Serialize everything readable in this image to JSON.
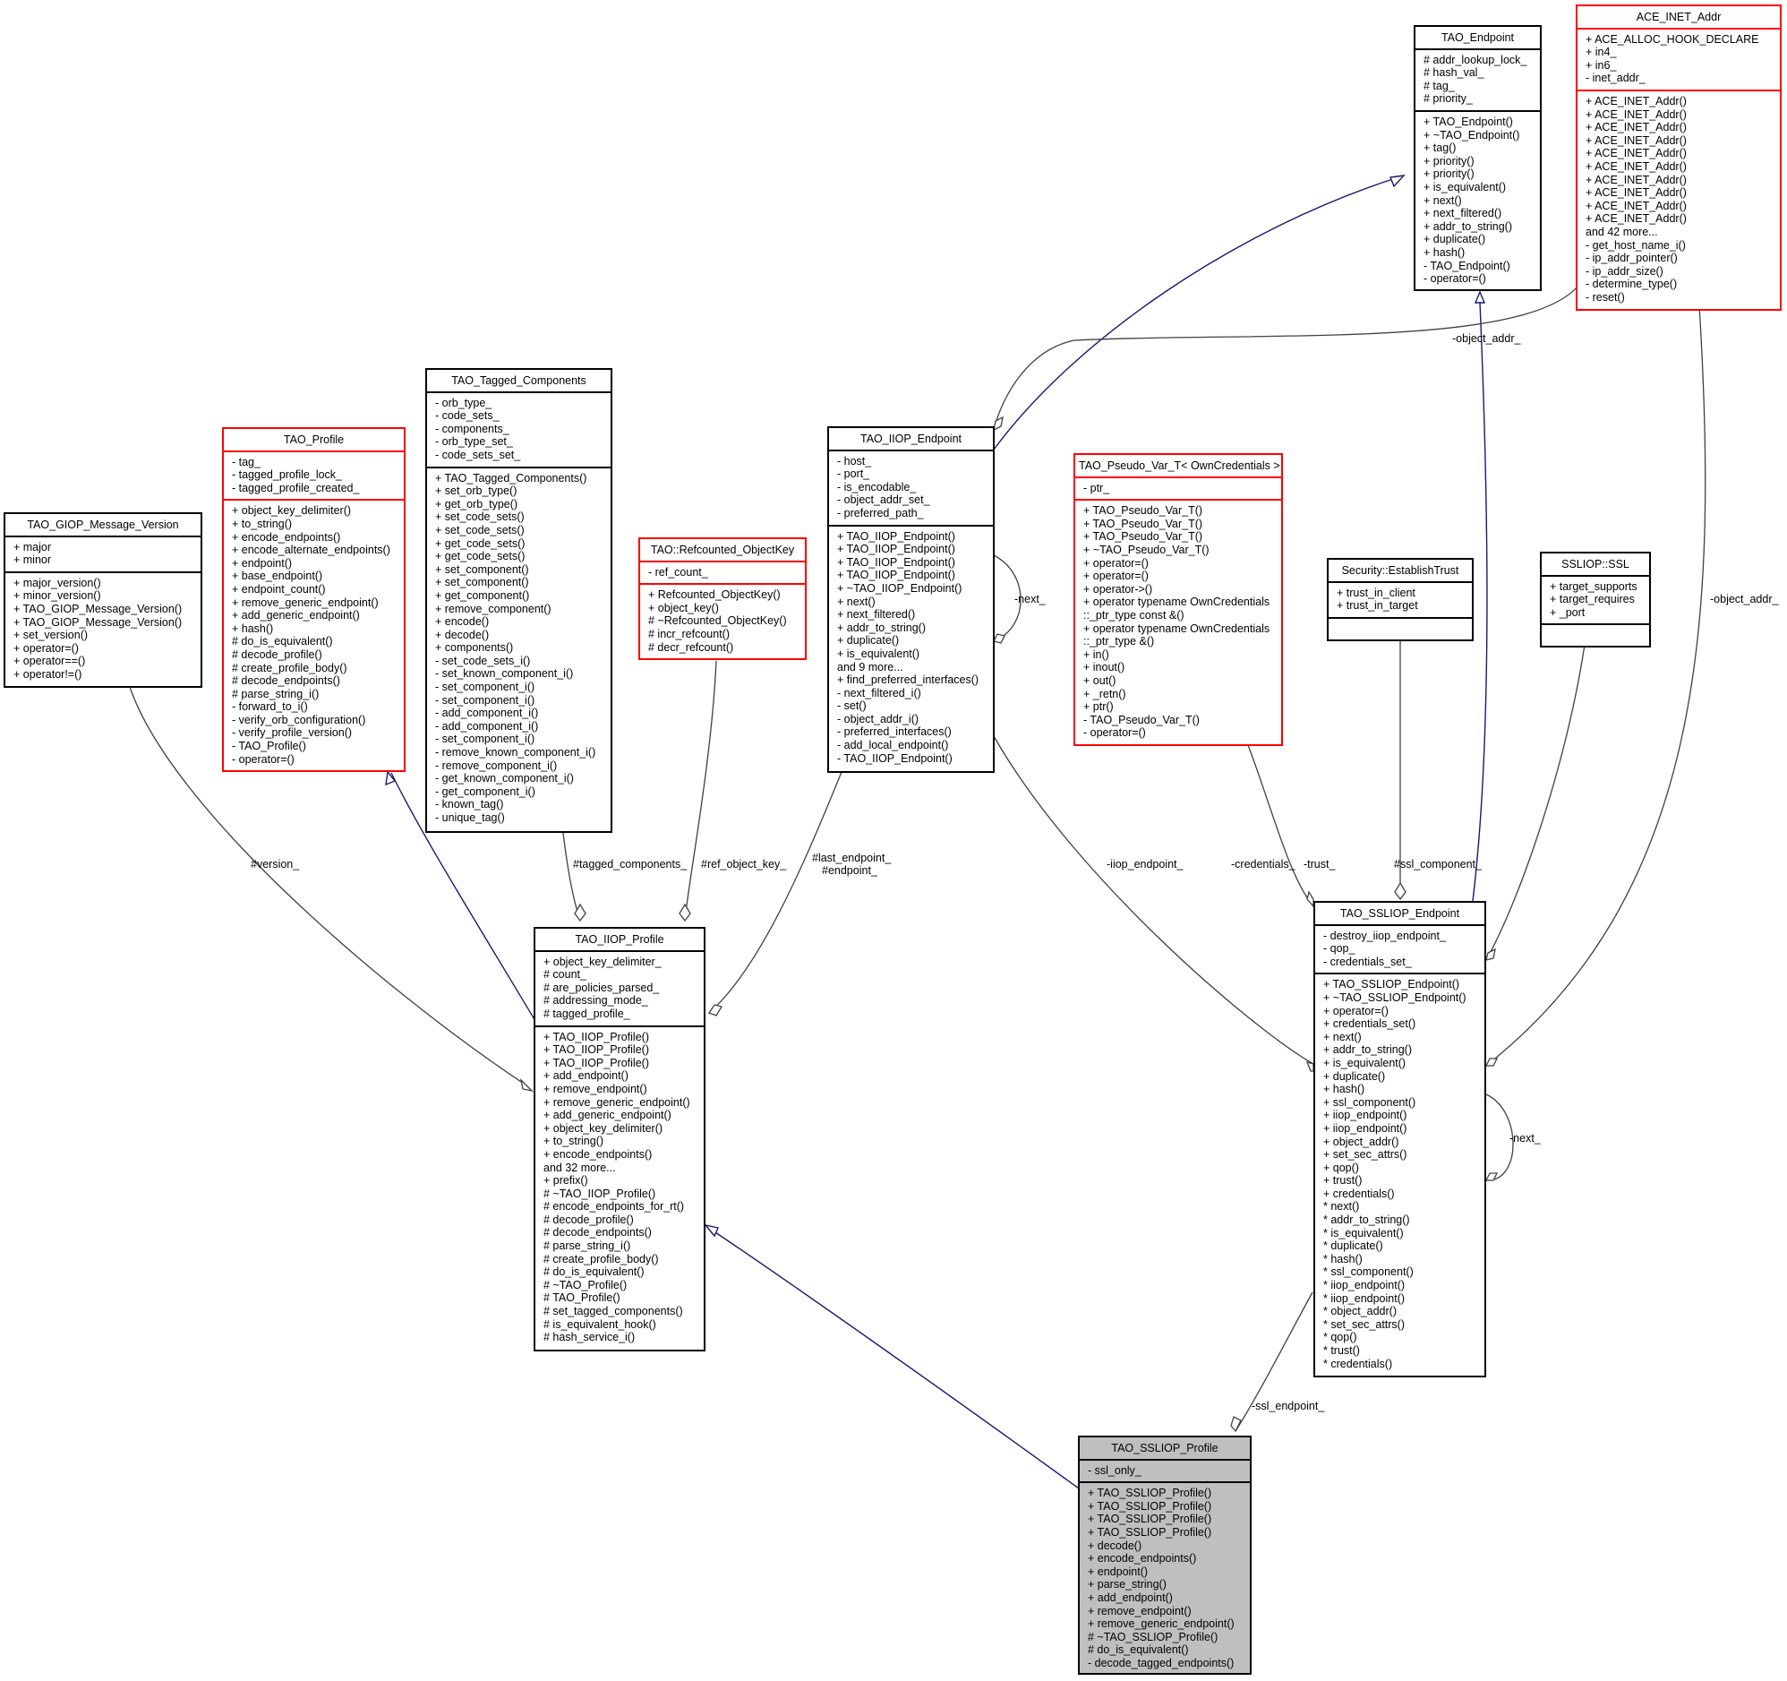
{
  "diagram": {
    "type": "uml-collaboration-diagram",
    "focus_class": "TAO_SSLIOP_Profile",
    "colors": {
      "normal_border": "#000000",
      "incomplete_border": "#ff0000",
      "focus_fill": "#bfbfbf",
      "inheritance_edge": "#191970",
      "usage_edge": "#404040"
    }
  },
  "classes": {
    "tao_endpoint": {
      "name": "TAO_Endpoint",
      "attributes": [
        "# addr_lookup_lock_",
        "# hash_val_",
        "# tag_",
        "# priority_"
      ],
      "methods": [
        "+ TAO_Endpoint()",
        "+ ~TAO_Endpoint()",
        "+ tag()",
        "+ priority()",
        "+ priority()",
        "+ is_equivalent()",
        "+ next()",
        "+ next_filtered()",
        "+ addr_to_string()",
        "+ duplicate()",
        "+ hash()",
        "- TAO_Endpoint()",
        "- operator=()"
      ]
    },
    "ace_inet_addr": {
      "name": "ACE_INET_Addr",
      "attributes": [
        "+ ACE_ALLOC_HOOK_DECLARE",
        "+ in4_",
        "+ in6_",
        "- inet_addr_"
      ],
      "methods": [
        "+ ACE_INET_Addr()",
        "+ ACE_INET_Addr()",
        "+ ACE_INET_Addr()",
        "+ ACE_INET_Addr()",
        "+ ACE_INET_Addr()",
        "+ ACE_INET_Addr()",
        "+ ACE_INET_Addr()",
        "+ ACE_INET_Addr()",
        "+ ACE_INET_Addr()",
        "+ ACE_INET_Addr()",
        "and 42 more...",
        "- get_host_name_i()",
        "- ip_addr_pointer()",
        "- ip_addr_size()",
        "- determine_type()",
        "- reset()"
      ]
    },
    "tao_tagged_components": {
      "name": "TAO_Tagged_Components",
      "attributes": [
        "- orb_type_",
        "- code_sets_",
        "- components_",
        "- orb_type_set_",
        "- code_sets_set_"
      ],
      "methods": [
        "+ TAO_Tagged_Components()",
        "+ set_orb_type()",
        "+ get_orb_type()",
        "+ set_code_sets()",
        "+ set_code_sets()",
        "+ get_code_sets()",
        "+ get_code_sets()",
        "+ set_component()",
        "+ set_component()",
        "+ get_component()",
        "+ remove_component()",
        "+ encode()",
        "+ decode()",
        "+ components()",
        "- set_code_sets_i()",
        "- set_known_component_i()",
        "- set_component_i()",
        "- set_component_i()",
        "- add_component_i()",
        "- add_component_i()",
        "- set_component_i()",
        "- remove_known_component_i()",
        "- remove_component_i()",
        "- get_known_component_i()",
        "- get_component_i()",
        "- known_tag()",
        "- unique_tag()"
      ]
    },
    "tao_profile": {
      "name": "TAO_Profile",
      "attributes": [
        "- tag_",
        "- tagged_profile_lock_",
        "- tagged_profile_created_"
      ],
      "methods": [
        "+ object_key_delimiter()",
        "+ to_string()",
        "+ encode_endpoints()",
        "+ encode_alternate_endpoints()",
        "+ endpoint()",
        "+ base_endpoint()",
        "+ endpoint_count()",
        "+ remove_generic_endpoint()",
        "+ add_generic_endpoint()",
        "+ hash()",
        "# do_is_equivalent()",
        "# decode_profile()",
        "# create_profile_body()",
        "# decode_endpoints()",
        "# parse_string_i()",
        "- forward_to_i()",
        "- verify_orb_configuration()",
        "- verify_profile_version()",
        "- TAO_Profile()",
        "- operator=()"
      ]
    },
    "tao_giop_message_version": {
      "name": "TAO_GIOP_Message_Version",
      "attributes": [
        "+ major",
        "+ minor"
      ],
      "methods": [
        "+ major_version()",
        "+ minor_version()",
        "+ TAO_GIOP_Message_Version()",
        "+ TAO_GIOP_Message_Version()",
        "+ set_version()",
        "+ operator=()",
        "+ operator==()",
        "+ operator!=()"
      ]
    },
    "tao_refcounted_objectkey": {
      "name": "TAO::Refcounted_ObjectKey",
      "attributes": [
        "- ref_count_"
      ],
      "methods": [
        "+ Refcounted_ObjectKey()",
        "+ object_key()",
        "# ~Refcounted_ObjectKey()",
        "# incr_refcount()",
        "# decr_refcount()"
      ]
    },
    "tao_iiop_endpoint": {
      "name": "TAO_IIOP_Endpoint",
      "attributes": [
        "- host_",
        "- port_",
        "- is_encodable_",
        "- object_addr_set_",
        "- preferred_path_"
      ],
      "methods": [
        "+ TAO_IIOP_Endpoint()",
        "+ TAO_IIOP_Endpoint()",
        "+ TAO_IIOP_Endpoint()",
        "+ TAO_IIOP_Endpoint()",
        "+ ~TAO_IIOP_Endpoint()",
        "+ next()",
        "+ next_filtered()",
        "+ addr_to_string()",
        "+ duplicate()",
        "+ is_equivalent()",
        "and 9 more...",
        "+ find_preferred_interfaces()",
        "- next_filtered_i()",
        "- set()",
        "- object_addr_i()",
        "- preferred_interfaces()",
        "- add_local_endpoint()",
        "- TAO_IIOP_Endpoint()"
      ]
    },
    "tao_pseudo_var_t": {
      "name": "TAO_Pseudo_Var_T< OwnCredentials >",
      "attributes": [
        "- ptr_"
      ],
      "methods": [
        "+ TAO_Pseudo_Var_T()",
        "+ TAO_Pseudo_Var_T()",
        "+ TAO_Pseudo_Var_T()",
        "+ ~TAO_Pseudo_Var_T()",
        "+ operator=()",
        "+ operator=()",
        "+ operator->()",
        "+ operator typename OwnCredentials",
        "::_ptr_type const &()",
        "+ operator typename OwnCredentials",
        "::_ptr_type &()",
        "+ in()",
        "+ inout()",
        "+ out()",
        "+ _retn()",
        "+ ptr()",
        "- TAO_Pseudo_Var_T()",
        "- operator=()"
      ]
    },
    "security_establishtrust": {
      "name": "Security::EstablishTrust",
      "attributes": [
        "+ trust_in_client",
        "+ trust_in_target"
      ],
      "methods": []
    },
    "ssliop_ssl": {
      "name": "SSLIOP::SSL",
      "attributes": [
        "+ target_supports",
        "+ target_requires",
        "+ _port"
      ],
      "methods": []
    },
    "tao_iiop_profile": {
      "name": "TAO_IIOP_Profile",
      "attributes": [
        "+ object_key_delimiter_",
        "# count_",
        "# are_policies_parsed_",
        "# addressing_mode_",
        "# tagged_profile_"
      ],
      "methods": [
        "+ TAO_IIOP_Profile()",
        "+ TAO_IIOP_Profile()",
        "+ TAO_IIOP_Profile()",
        "+ add_endpoint()",
        "+ remove_endpoint()",
        "+ remove_generic_endpoint()",
        "+ add_generic_endpoint()",
        "+ object_key_delimiter()",
        "+ to_string()",
        "+ encode_endpoints()",
        "and 32 more...",
        "+ prefix()",
        "# ~TAO_IIOP_Profile()",
        "# encode_endpoints_for_rt()",
        "# decode_profile()",
        "# decode_endpoints()",
        "# parse_string_i()",
        "# create_profile_body()",
        "# do_is_equivalent()",
        "# ~TAO_Profile()",
        "# TAO_Profile()",
        "# set_tagged_components()",
        "# is_equivalent_hook()",
        "# hash_service_i()"
      ]
    },
    "tao_ssliop_endpoint": {
      "name": "TAO_SSLIOP_Endpoint",
      "attributes": [
        "- destroy_iiop_endpoint_",
        "- qop_",
        "- credentials_set_"
      ],
      "methods": [
        "+ TAO_SSLIOP_Endpoint()",
        "+ ~TAO_SSLIOP_Endpoint()",
        "+ operator=()",
        "+ credentials_set()",
        "+ next()",
        "+ addr_to_string()",
        "+ is_equivalent()",
        "+ duplicate()",
        "+ hash()",
        "+ ssl_component()",
        "+ iiop_endpoint()",
        "+ iiop_endpoint()",
        "+ object_addr()",
        "+ set_sec_attrs()",
        "+ qop()",
        "+ trust()",
        "+ credentials()",
        "* next()",
        "* addr_to_string()",
        "* is_equivalent()",
        "* duplicate()",
        "* hash()",
        "* ssl_component()",
        "* iiop_endpoint()",
        "* iiop_endpoint()",
        "* object_addr()",
        "* set_sec_attrs()",
        "* qop()",
        "* trust()",
        "* credentials()"
      ]
    },
    "tao_ssliop_profile": {
      "name": "TAO_SSLIOP_Profile",
      "attributes": [
        "- ssl_only_"
      ],
      "methods": [
        "+ TAO_SSLIOP_Profile()",
        "+ TAO_SSLIOP_Profile()",
        "+ TAO_SSLIOP_Profile()",
        "+ TAO_SSLIOP_Profile()",
        "+ decode()",
        "+ encode_endpoints()",
        "+ endpoint()",
        "+ parse_string()",
        "+ add_endpoint()",
        "+ remove_endpoint()",
        "+ remove_generic_endpoint()",
        "# ~TAO_SSLIOP_Profile()",
        "# do_is_equivalent()",
        "- decode_tagged_endpoints()"
      ]
    }
  },
  "edge_labels": {
    "version": "#version_",
    "tagged_components": "#tagged_components_",
    "ref_object_key": "#ref_object_key_",
    "last_endpoint": "#last_endpoint_",
    "endpoint": "#endpoint_",
    "iiop_next": "-next_",
    "object_addr_iiop": "-object_addr_",
    "object_addr_ssliop": "-object_addr_",
    "iiop_endpoint": "-iiop_endpoint_",
    "credentials": "-credentials_",
    "trust": "-trust_",
    "ssl_component": "#ssl_component_",
    "ssliop_next": "-next_",
    "ssl_endpoint": "-ssl_endpoint_"
  }
}
